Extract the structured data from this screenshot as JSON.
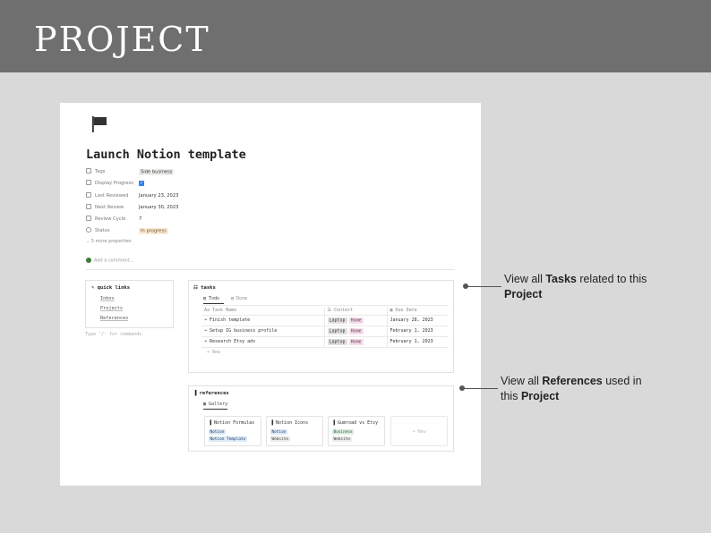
{
  "banner": {
    "title": "PROJECT"
  },
  "page": {
    "icon": "flag-icon",
    "title": "Launch Notion template",
    "properties": [
      {
        "name": "Tags",
        "value": "Side business",
        "icon": "list-icon"
      },
      {
        "name": "Display Progress",
        "value": "✓",
        "icon": "checkbox-icon"
      },
      {
        "name": "Last Reviewed",
        "value": "January 23, 2023",
        "icon": "calendar-icon"
      },
      {
        "name": "Next Review",
        "value": "January 30, 2023",
        "icon": "formula-icon"
      },
      {
        "name": "Review Cycle",
        "value": "7",
        "icon": "number-icon"
      },
      {
        "name": "Status",
        "value": "In progress",
        "icon": "status-icon"
      }
    ],
    "more_properties": "5 more properties",
    "comment_placeholder": "Add a comment..."
  },
  "quick_links": {
    "title": "quick links",
    "items": [
      "Inbox",
      "Projects",
      "References"
    ],
    "hint": "Type '/' for commands"
  },
  "tasks": {
    "title": "tasks",
    "tabs": [
      "Todo",
      "Done"
    ],
    "columns": [
      "Task Name",
      "Context",
      "Due Date"
    ],
    "rows": [
      {
        "name": "Finish template",
        "ctx1": "Laptop",
        "ctx2": "Home",
        "due": "January 28, 2023"
      },
      {
        "name": "Setup IG business profile",
        "ctx1": "Laptop",
        "ctx2": "Home",
        "due": "February 1, 2023"
      },
      {
        "name": "Research Etsy ads",
        "ctx1": "Laptop",
        "ctx2": "Home",
        "due": "February 1, 2023"
      }
    ],
    "new_label": "+ New"
  },
  "references": {
    "title": "references",
    "tab": "Gallery",
    "cards": [
      {
        "title": "Notion Formulas",
        "tag1": "Notion",
        "tag2": "Notion Template"
      },
      {
        "title": "Notion Icons",
        "tag1": "Notion",
        "tag2": "Website"
      },
      {
        "title": "Gumroad vs Etsy",
        "tag1": "Business",
        "tag2": "Website"
      }
    ],
    "new_label": "+ New"
  },
  "callouts": {
    "tasks": {
      "pre": "View all ",
      "bold": "Tasks",
      "mid": " related to this",
      "bold2": "Project"
    },
    "references": {
      "pre": "View all ",
      "bold": "References",
      "mid": " used in",
      "post": "this ",
      "bold2": "Project"
    }
  },
  "colors": {
    "banner": "#6f6f6f",
    "background": "#d9d9d9",
    "checkbox": "#2f80ed"
  }
}
